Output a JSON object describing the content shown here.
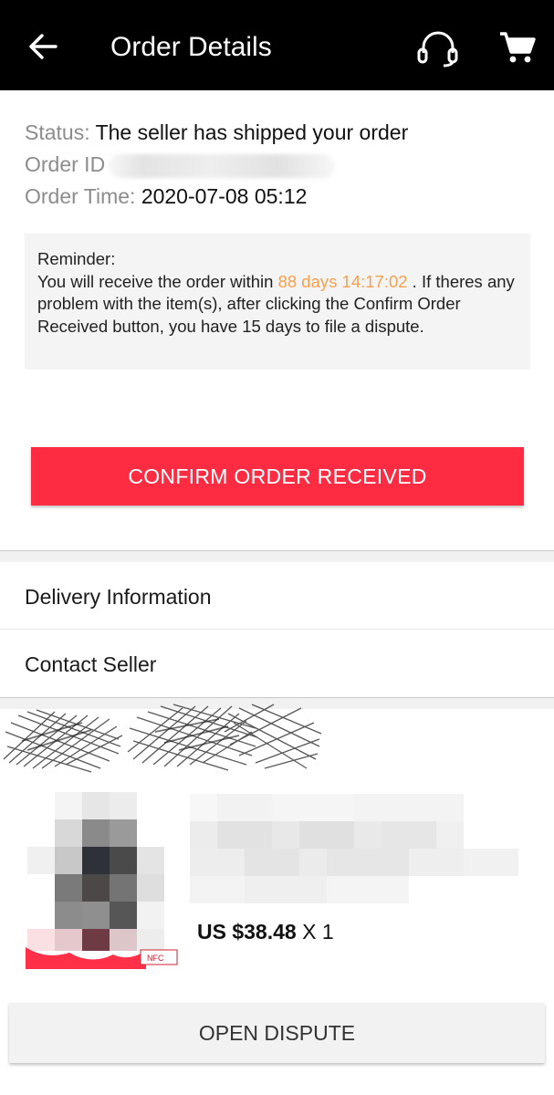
{
  "header": {
    "title": "Order Details",
    "icons": [
      "back-arrow-icon",
      "headset-icon",
      "cart-icon"
    ]
  },
  "order": {
    "status_label": "Status:",
    "status_value": "The seller has shipped your order",
    "id_label": "Order ID",
    "time_label": "Order Time:",
    "time_value": "2020-07-08 05:12"
  },
  "reminder": {
    "title": "Reminder:",
    "text_before": "You will receive the order within ",
    "countdown": "88 days 14:17:02",
    "text_after": " . If theres any problem with the item(s), after clicking the Confirm Order Received button, you have 15 days to file a dispute.",
    "highlight_color": "#f7a050"
  },
  "actions": {
    "confirm_label": "CONFIRM ORDER RECEIVED",
    "confirm_color": "#fe2c43",
    "dispute_label": "OPEN DISPUTE"
  },
  "menu": {
    "delivery_label": "Delivery Information",
    "contact_label": "Contact Seller"
  },
  "product": {
    "price": "US $38.48",
    "quantity": "X 1",
    "badge_text": "NFC"
  }
}
